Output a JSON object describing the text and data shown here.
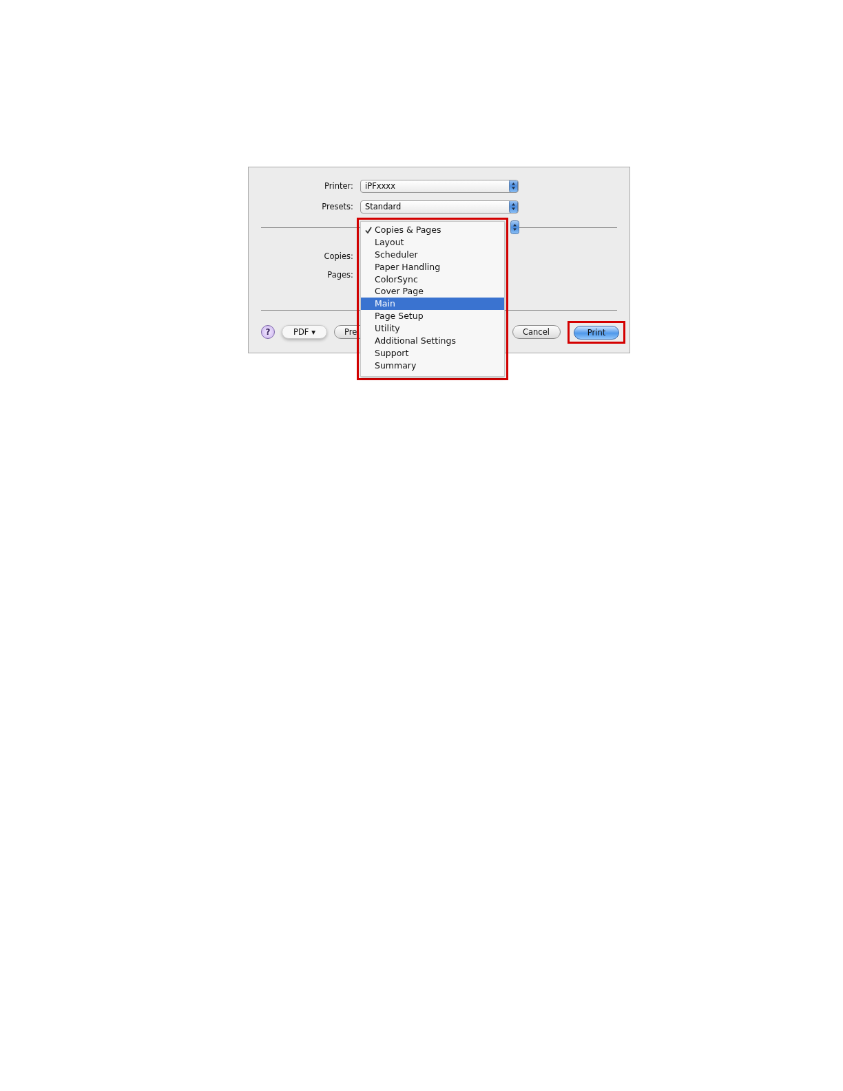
{
  "dialog": {
    "printer": {
      "label": "Printer:",
      "value": "iPFxxxx"
    },
    "presets": {
      "label": "Presets:",
      "value": "Standard"
    },
    "copies_label": "Copies:",
    "pages_label": "Pages:",
    "buttons": [
      {
        "kind": "help",
        "label": "?",
        "highlighted": false
      },
      {
        "kind": "menu",
        "label": "PDF ▾",
        "highlighted": false
      },
      {
        "kind": "plain",
        "label": "Pre",
        "highlighted": false
      },
      {
        "kind": "plain",
        "label": "Cancel",
        "highlighted": false
      },
      {
        "kind": "default",
        "label": "Print",
        "highlighted": true
      }
    ]
  },
  "menu": {
    "highlighted": true,
    "items": [
      {
        "label": "Copies & Pages",
        "checked": true,
        "selected": false
      },
      {
        "label": "Layout",
        "checked": false,
        "selected": false
      },
      {
        "label": "Scheduler",
        "checked": false,
        "selected": false
      },
      {
        "label": "Paper Handling",
        "checked": false,
        "selected": false
      },
      {
        "label": "ColorSync",
        "checked": false,
        "selected": false
      },
      {
        "label": "Cover Page",
        "checked": false,
        "selected": false
      },
      {
        "label": "Main",
        "checked": false,
        "selected": true
      },
      {
        "label": "Page Setup",
        "checked": false,
        "selected": false
      },
      {
        "label": "Utility",
        "checked": false,
        "selected": false
      },
      {
        "label": "Additional Settings",
        "checked": false,
        "selected": false
      },
      {
        "label": "Support",
        "checked": false,
        "selected": false
      },
      {
        "label": "Summary",
        "checked": false,
        "selected": false
      }
    ]
  }
}
